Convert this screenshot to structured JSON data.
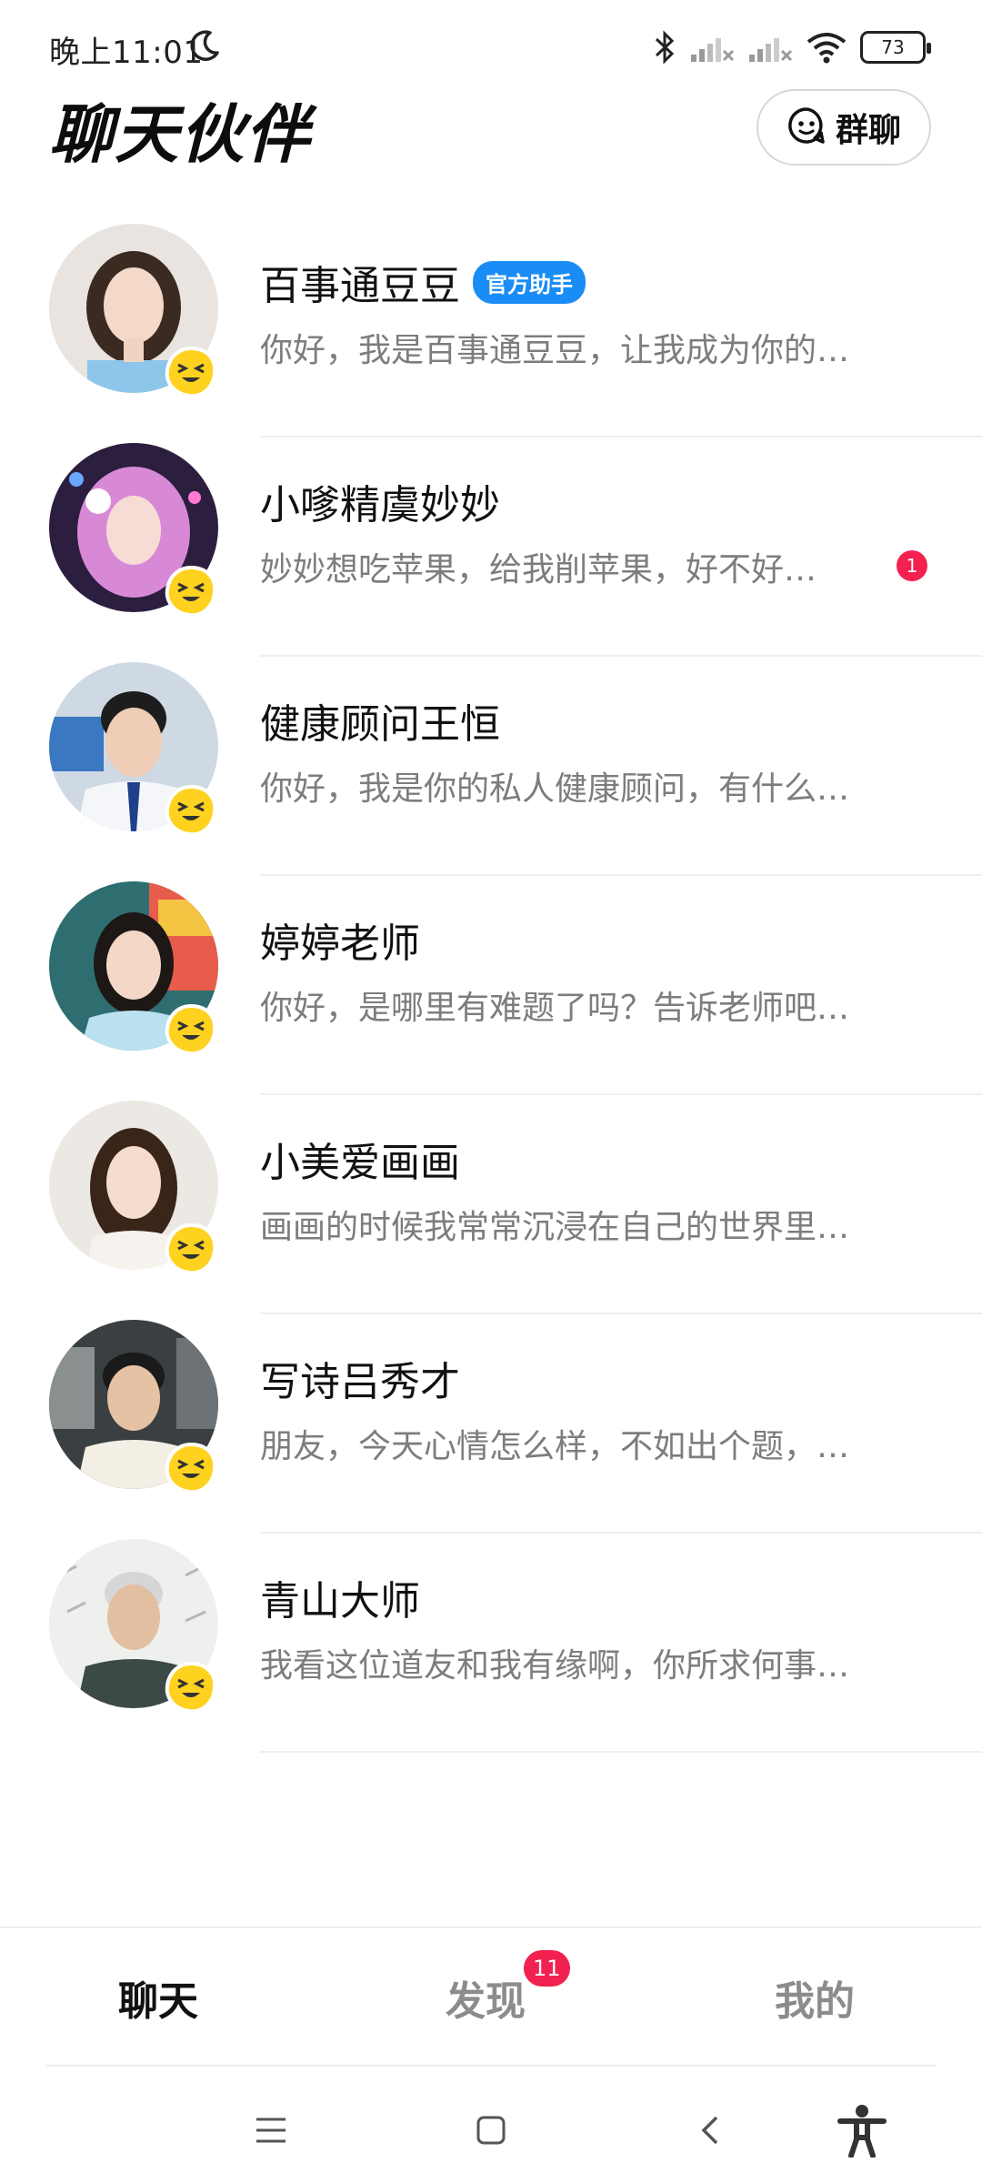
{
  "status_bar": {
    "time": "晚上11:01",
    "battery": "73"
  },
  "header": {
    "title": "聊天伙伴",
    "group_chat_label": "群聊"
  },
  "chats": [
    {
      "name": "百事通豆豆",
      "badge": "官方助手",
      "preview": "你好，我是百事通豆豆，让我成为你的…",
      "unread": ""
    },
    {
      "name": "小嗲精虞妙妙",
      "badge": "",
      "preview": "妙妙想吃苹果，给我削苹果，好不好…",
      "unread": "1"
    },
    {
      "name": "健康顾问王恒",
      "badge": "",
      "preview": "你好，我是你的私人健康顾问，有什么…",
      "unread": ""
    },
    {
      "name": "婷婷老师",
      "badge": "",
      "preview": "你好，是哪里有难题了吗？告诉老师吧…",
      "unread": ""
    },
    {
      "name": "小美爱画画",
      "badge": "",
      "preview": "画画的时候我常常沉浸在自己的世界里…",
      "unread": ""
    },
    {
      "name": "写诗吕秀才",
      "badge": "",
      "preview": "朋友，今天心情怎么样，不如出个题，…",
      "unread": ""
    },
    {
      "name": "青山大师",
      "badge": "",
      "preview": "我看这位道友和我有缘啊，你所求何事…",
      "unread": ""
    }
  ],
  "tabs": {
    "chat": "聊天",
    "discover": "发现",
    "discover_badge": "11",
    "mine": "我的"
  },
  "colors": {
    "accent_blue": "#1a8cf5",
    "badge_red": "#f2214f",
    "emoji_yellow": "#ffd21f"
  }
}
